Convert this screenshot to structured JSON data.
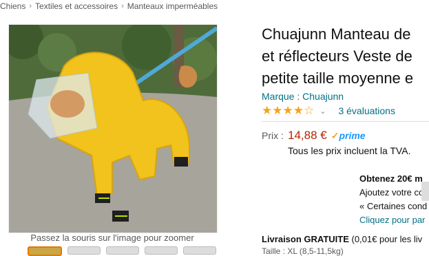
{
  "breadcrumb": {
    "items": [
      "Chiens",
      "Textiles et accessoires",
      "Manteaux imperméables"
    ],
    "separator": "›"
  },
  "gallery": {
    "hint": "Passez la souris sur l'image pour zoomer",
    "thumbnail_count": 5
  },
  "product": {
    "title_lines": [
      "Chuajunn Manteau de",
      "et réflecteurs Veste de",
      "petite taille moyenne e"
    ],
    "brand": "Marque : Chuajunn",
    "rating_stars": 4,
    "rating_count": "3 évaluations",
    "price_label": "Prix :",
    "price": "14,88 €",
    "prime_label": "prime",
    "tax_note": "Tous les prix incluent la TVA."
  },
  "promo": {
    "line1": "Obtenez 20€ m",
    "line2": "Ajoutez votre co",
    "line3": "« Certaines cond",
    "line4": "Cliquez pour par"
  },
  "delivery": {
    "label": "Livraison GRATUITE",
    "detail": " (0,01€ pour les liv",
    "size_line": "Taille : XL (8,5-11,5kg)"
  },
  "colors": {
    "link": "#007185",
    "price": "#b12704",
    "star": "#f4a41d",
    "prime": "#1a98ff"
  }
}
